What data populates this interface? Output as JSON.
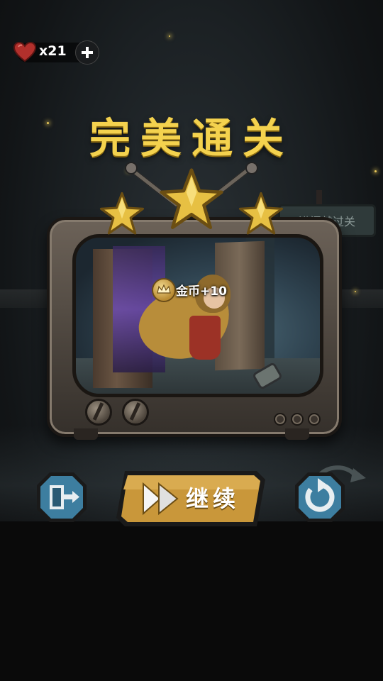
{
  "hud": {
    "lives_count": "x21",
    "heart_icon": "heart-icon",
    "add_icon": "plus-icon"
  },
  "title": "完美通关",
  "stars_earned": 3,
  "stars_total": 3,
  "background_sign": "进门就过关",
  "reward": {
    "label": "金币+10",
    "icon": "crown-coin-icon"
  },
  "buttons": {
    "exit_icon": "exit-door-icon",
    "continue_label": "继续",
    "continue_icon": "fast-forward-icon",
    "replay_icon": "replay-icon"
  },
  "colors": {
    "gold": "#f4d24e",
    "button_gold": "#c9973a",
    "button_teal": "#3d7ea0"
  }
}
